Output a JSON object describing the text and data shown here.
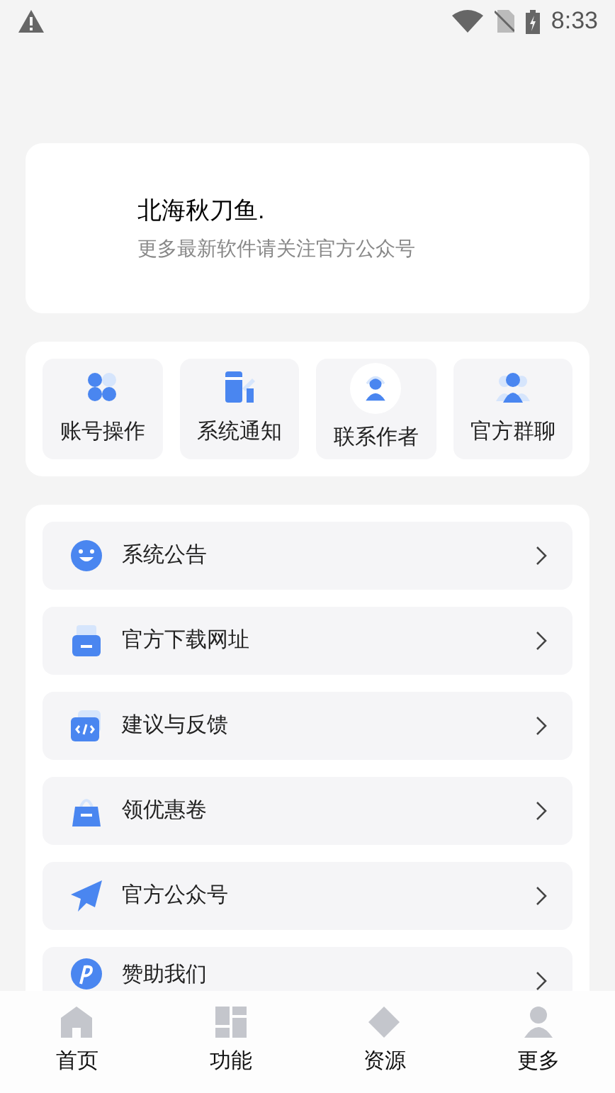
{
  "status_bar": {
    "time": "8:33"
  },
  "profile": {
    "name": "北海秋刀鱼.",
    "subtitle": "更多最新软件请关注官方公众号"
  },
  "shortcuts": [
    {
      "label": "账号操作",
      "kind": "clover"
    },
    {
      "label": "系统通知",
      "kind": "doc"
    },
    {
      "label": "联系作者",
      "kind": "headset"
    },
    {
      "label": "官方群聊",
      "kind": "group"
    }
  ],
  "menu": [
    {
      "label": "系统公告",
      "kind": "smile"
    },
    {
      "label": "官方下载网址",
      "kind": "printer"
    },
    {
      "label": "建议与反馈",
      "kind": "code"
    },
    {
      "label": "领优惠卷",
      "kind": "bag"
    },
    {
      "label": "官方公众号",
      "kind": "plane"
    },
    {
      "label": "赞助我们",
      "kind": "coin"
    }
  ],
  "bottom_nav": [
    {
      "label": "首页",
      "kind": "home"
    },
    {
      "label": "功能",
      "kind": "grid"
    },
    {
      "label": "资源",
      "kind": "diamond"
    },
    {
      "label": "更多",
      "kind": "person"
    }
  ]
}
